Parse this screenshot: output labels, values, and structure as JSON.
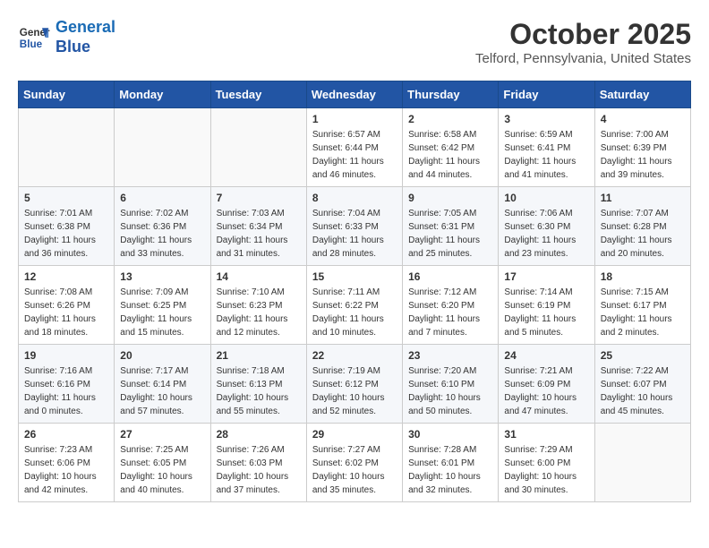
{
  "header": {
    "logo_line1": "General",
    "logo_line2": "Blue",
    "month": "October 2025",
    "location": "Telford, Pennsylvania, United States"
  },
  "weekdays": [
    "Sunday",
    "Monday",
    "Tuesday",
    "Wednesday",
    "Thursday",
    "Friday",
    "Saturday"
  ],
  "weeks": [
    [
      {
        "day": "",
        "info": ""
      },
      {
        "day": "",
        "info": ""
      },
      {
        "day": "",
        "info": ""
      },
      {
        "day": "1",
        "info": "Sunrise: 6:57 AM\nSunset: 6:44 PM\nDaylight: 11 hours\nand 46 minutes."
      },
      {
        "day": "2",
        "info": "Sunrise: 6:58 AM\nSunset: 6:42 PM\nDaylight: 11 hours\nand 44 minutes."
      },
      {
        "day": "3",
        "info": "Sunrise: 6:59 AM\nSunset: 6:41 PM\nDaylight: 11 hours\nand 41 minutes."
      },
      {
        "day": "4",
        "info": "Sunrise: 7:00 AM\nSunset: 6:39 PM\nDaylight: 11 hours\nand 39 minutes."
      }
    ],
    [
      {
        "day": "5",
        "info": "Sunrise: 7:01 AM\nSunset: 6:38 PM\nDaylight: 11 hours\nand 36 minutes."
      },
      {
        "day": "6",
        "info": "Sunrise: 7:02 AM\nSunset: 6:36 PM\nDaylight: 11 hours\nand 33 minutes."
      },
      {
        "day": "7",
        "info": "Sunrise: 7:03 AM\nSunset: 6:34 PM\nDaylight: 11 hours\nand 31 minutes."
      },
      {
        "day": "8",
        "info": "Sunrise: 7:04 AM\nSunset: 6:33 PM\nDaylight: 11 hours\nand 28 minutes."
      },
      {
        "day": "9",
        "info": "Sunrise: 7:05 AM\nSunset: 6:31 PM\nDaylight: 11 hours\nand 25 minutes."
      },
      {
        "day": "10",
        "info": "Sunrise: 7:06 AM\nSunset: 6:30 PM\nDaylight: 11 hours\nand 23 minutes."
      },
      {
        "day": "11",
        "info": "Sunrise: 7:07 AM\nSunset: 6:28 PM\nDaylight: 11 hours\nand 20 minutes."
      }
    ],
    [
      {
        "day": "12",
        "info": "Sunrise: 7:08 AM\nSunset: 6:26 PM\nDaylight: 11 hours\nand 18 minutes."
      },
      {
        "day": "13",
        "info": "Sunrise: 7:09 AM\nSunset: 6:25 PM\nDaylight: 11 hours\nand 15 minutes."
      },
      {
        "day": "14",
        "info": "Sunrise: 7:10 AM\nSunset: 6:23 PM\nDaylight: 11 hours\nand 12 minutes."
      },
      {
        "day": "15",
        "info": "Sunrise: 7:11 AM\nSunset: 6:22 PM\nDaylight: 11 hours\nand 10 minutes."
      },
      {
        "day": "16",
        "info": "Sunrise: 7:12 AM\nSunset: 6:20 PM\nDaylight: 11 hours\nand 7 minutes."
      },
      {
        "day": "17",
        "info": "Sunrise: 7:14 AM\nSunset: 6:19 PM\nDaylight: 11 hours\nand 5 minutes."
      },
      {
        "day": "18",
        "info": "Sunrise: 7:15 AM\nSunset: 6:17 PM\nDaylight: 11 hours\nand 2 minutes."
      }
    ],
    [
      {
        "day": "19",
        "info": "Sunrise: 7:16 AM\nSunset: 6:16 PM\nDaylight: 11 hours\nand 0 minutes."
      },
      {
        "day": "20",
        "info": "Sunrise: 7:17 AM\nSunset: 6:14 PM\nDaylight: 10 hours\nand 57 minutes."
      },
      {
        "day": "21",
        "info": "Sunrise: 7:18 AM\nSunset: 6:13 PM\nDaylight: 10 hours\nand 55 minutes."
      },
      {
        "day": "22",
        "info": "Sunrise: 7:19 AM\nSunset: 6:12 PM\nDaylight: 10 hours\nand 52 minutes."
      },
      {
        "day": "23",
        "info": "Sunrise: 7:20 AM\nSunset: 6:10 PM\nDaylight: 10 hours\nand 50 minutes."
      },
      {
        "day": "24",
        "info": "Sunrise: 7:21 AM\nSunset: 6:09 PM\nDaylight: 10 hours\nand 47 minutes."
      },
      {
        "day": "25",
        "info": "Sunrise: 7:22 AM\nSunset: 6:07 PM\nDaylight: 10 hours\nand 45 minutes."
      }
    ],
    [
      {
        "day": "26",
        "info": "Sunrise: 7:23 AM\nSunset: 6:06 PM\nDaylight: 10 hours\nand 42 minutes."
      },
      {
        "day": "27",
        "info": "Sunrise: 7:25 AM\nSunset: 6:05 PM\nDaylight: 10 hours\nand 40 minutes."
      },
      {
        "day": "28",
        "info": "Sunrise: 7:26 AM\nSunset: 6:03 PM\nDaylight: 10 hours\nand 37 minutes."
      },
      {
        "day": "29",
        "info": "Sunrise: 7:27 AM\nSunset: 6:02 PM\nDaylight: 10 hours\nand 35 minutes."
      },
      {
        "day": "30",
        "info": "Sunrise: 7:28 AM\nSunset: 6:01 PM\nDaylight: 10 hours\nand 32 minutes."
      },
      {
        "day": "31",
        "info": "Sunrise: 7:29 AM\nSunset: 6:00 PM\nDaylight: 10 hours\nand 30 minutes."
      },
      {
        "day": "",
        "info": ""
      }
    ]
  ]
}
